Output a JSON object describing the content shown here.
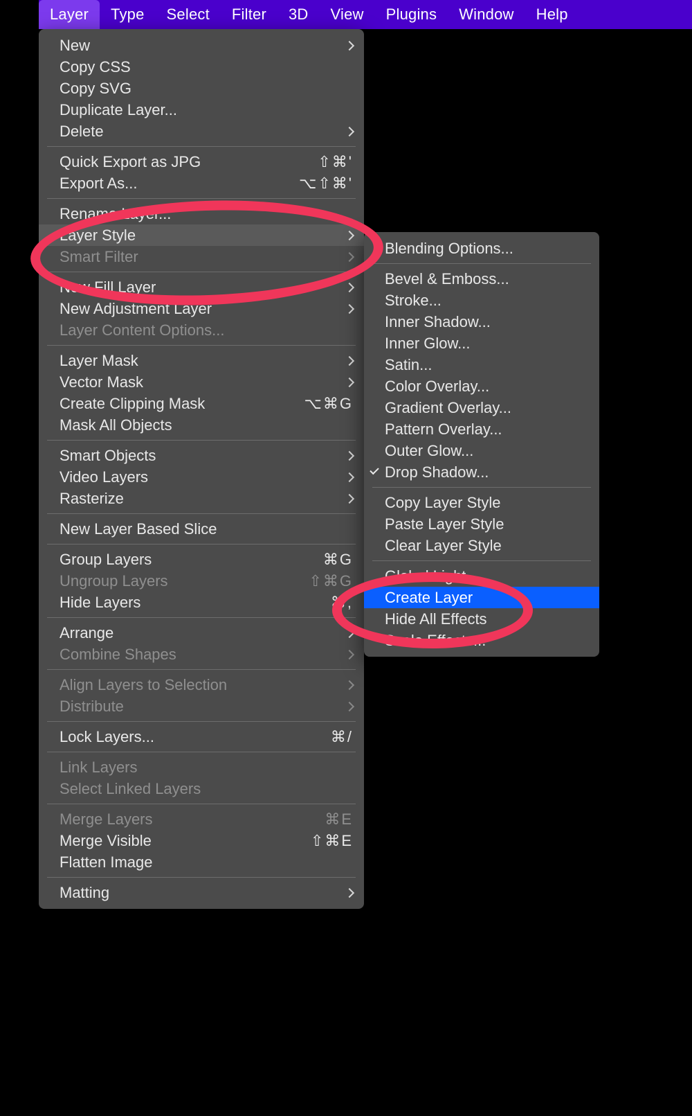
{
  "menubar": {
    "items": [
      {
        "label": "Layer",
        "active": true
      },
      {
        "label": "Type"
      },
      {
        "label": "Select"
      },
      {
        "label": "Filter"
      },
      {
        "label": "3D"
      },
      {
        "label": "View"
      },
      {
        "label": "Plugins"
      },
      {
        "label": "Window"
      },
      {
        "label": "Help"
      }
    ]
  },
  "layer_menu": {
    "groups": [
      [
        {
          "label": "New",
          "submenu": true
        },
        {
          "label": "Copy CSS"
        },
        {
          "label": "Copy SVG"
        },
        {
          "label": "Duplicate Layer..."
        },
        {
          "label": "Delete",
          "submenu": true
        }
      ],
      [
        {
          "label": "Quick Export as JPG",
          "shortcut": "⇧⌘'"
        },
        {
          "label": "Export As...",
          "shortcut": "⌥⇧⌘'"
        }
      ],
      [
        {
          "label": "Rename Layer..."
        },
        {
          "label": "Layer Style",
          "submenu": true,
          "hover": true
        },
        {
          "label": "Smart Filter",
          "submenu": true,
          "disabled": true
        }
      ],
      [
        {
          "label": "New Fill Layer",
          "submenu": true
        },
        {
          "label": "New Adjustment Layer",
          "submenu": true
        },
        {
          "label": "Layer Content Options...",
          "disabled": true
        }
      ],
      [
        {
          "label": "Layer Mask",
          "submenu": true
        },
        {
          "label": "Vector Mask",
          "submenu": true
        },
        {
          "label": "Create Clipping Mask",
          "shortcut": "⌥⌘G"
        },
        {
          "label": "Mask All Objects"
        }
      ],
      [
        {
          "label": "Smart Objects",
          "submenu": true
        },
        {
          "label": "Video Layers",
          "submenu": true
        },
        {
          "label": "Rasterize",
          "submenu": true
        }
      ],
      [
        {
          "label": "New Layer Based Slice"
        }
      ],
      [
        {
          "label": "Group Layers",
          "shortcut": "⌘G"
        },
        {
          "label": "Ungroup Layers",
          "shortcut": "⇧⌘G",
          "disabled": true
        },
        {
          "label": "Hide Layers",
          "shortcut": "⌘,"
        }
      ],
      [
        {
          "label": "Arrange",
          "submenu": true
        },
        {
          "label": "Combine Shapes",
          "submenu": true,
          "disabled": true
        }
      ],
      [
        {
          "label": "Align Layers to Selection",
          "submenu": true,
          "disabled": true
        },
        {
          "label": "Distribute",
          "submenu": true,
          "disabled": true
        }
      ],
      [
        {
          "label": "Lock Layers...",
          "shortcut": "⌘/"
        }
      ],
      [
        {
          "label": "Link Layers",
          "disabled": true
        },
        {
          "label": "Select Linked Layers",
          "disabled": true
        }
      ],
      [
        {
          "label": "Merge Layers",
          "shortcut": "⌘E",
          "disabled": true
        },
        {
          "label": "Merge Visible",
          "shortcut": "⇧⌘E"
        },
        {
          "label": "Flatten Image"
        }
      ],
      [
        {
          "label": "Matting",
          "submenu": true
        }
      ]
    ]
  },
  "layer_style_submenu": {
    "groups": [
      [
        {
          "label": "Blending Options..."
        }
      ],
      [
        {
          "label": "Bevel & Emboss..."
        },
        {
          "label": "Stroke..."
        },
        {
          "label": "Inner Shadow..."
        },
        {
          "label": "Inner Glow..."
        },
        {
          "label": "Satin..."
        },
        {
          "label": "Color Overlay..."
        },
        {
          "label": "Gradient Overlay..."
        },
        {
          "label": "Pattern Overlay..."
        },
        {
          "label": "Outer Glow..."
        },
        {
          "label": "Drop Shadow...",
          "checked": true
        }
      ],
      [
        {
          "label": "Copy Layer Style"
        },
        {
          "label": "Paste Layer Style"
        },
        {
          "label": "Clear Layer Style"
        }
      ],
      [
        {
          "label": "Global Light..."
        },
        {
          "label": "Create Layer",
          "hilite": true
        },
        {
          "label": "Hide All Effects"
        },
        {
          "label": "Scale Effects..."
        }
      ]
    ]
  }
}
